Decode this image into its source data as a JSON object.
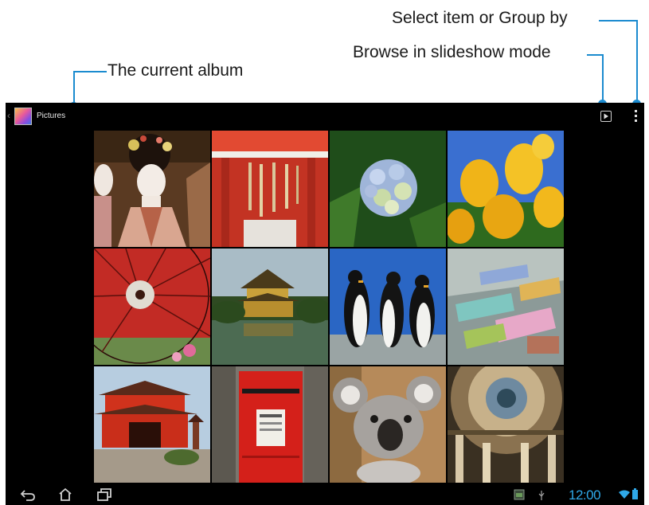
{
  "callouts": {
    "select_group": "Select item or Group by",
    "slideshow": "Browse in slideshow mode",
    "album": "The current album"
  },
  "action_bar": {
    "album_title": "Pictures",
    "icons": [
      "album-thumbnail-icon",
      "slideshow-icon",
      "overflow-menu-icon"
    ]
  },
  "photos": [
    {
      "subject": "geisha-portrait"
    },
    {
      "subject": "red-shrine-gate"
    },
    {
      "subject": "blue-hydrangea"
    },
    {
      "subject": "yellow-tulips"
    },
    {
      "subject": "red-parasol"
    },
    {
      "subject": "golden-pavilion"
    },
    {
      "subject": "penguins"
    },
    {
      "subject": "colorful-benches"
    },
    {
      "subject": "red-pagoda-temple"
    },
    {
      "subject": "red-post-box"
    },
    {
      "subject": "koala"
    },
    {
      "subject": "domed-ceiling"
    }
  ],
  "system_bar": {
    "clock": "12:00",
    "icons": [
      "back-icon",
      "home-icon",
      "recent-apps-icon",
      "gallery-notification-icon",
      "usb-icon",
      "wifi-icon",
      "battery-icon"
    ]
  },
  "colors": {
    "callout_line": "#1b8bcf",
    "clock": "#2fa8e8",
    "screen_bg": "#000000"
  }
}
